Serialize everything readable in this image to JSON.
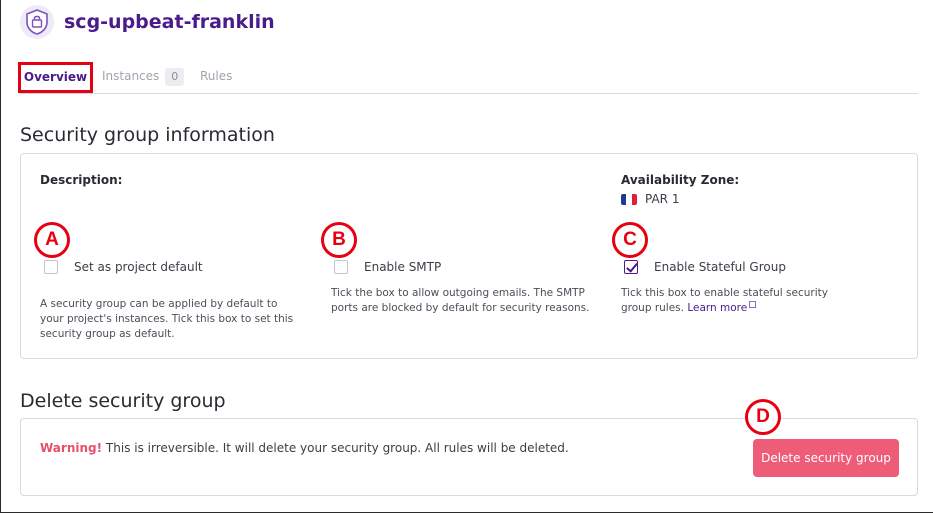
{
  "header": {
    "title": "scg-upbeat-franklin",
    "logo_icon": "shield-lock-icon"
  },
  "tabs": {
    "overview": "Overview",
    "instances": "Instances",
    "instances_count": "0",
    "rules": "Rules"
  },
  "info_section": {
    "title": "Security group information",
    "description_label": "Description:",
    "availability_zone_label": "Availability Zone:",
    "availability_zone_value": "PAR 1",
    "zone_flag_icon": "france-flag-icon",
    "options": [
      {
        "badge": "A",
        "label": "Set as project default",
        "checked": false,
        "help": "A security group can be applied by default to your project's instances. Tick this box to set this security group as default."
      },
      {
        "badge": "B",
        "label": "Enable SMTP",
        "checked": false,
        "help": "Tick the box to allow outgoing emails. The SMTP ports are blocked by default for security reasons."
      },
      {
        "badge": "C",
        "label": "Enable Stateful Group",
        "checked": true,
        "help": "Tick this box to enable stateful security group rules.",
        "link": "Learn more"
      }
    ]
  },
  "delete_section": {
    "title": "Delete security group",
    "warning_strong": "Warning!",
    "warning_text": "This is irreversible. It will delete your security group. All rules will be deleted.",
    "badge": "D",
    "button_label": "Delete security group"
  },
  "colors": {
    "brand": "#4a1b8a",
    "danger": "#ef5c78",
    "annotation": "#e60012"
  }
}
